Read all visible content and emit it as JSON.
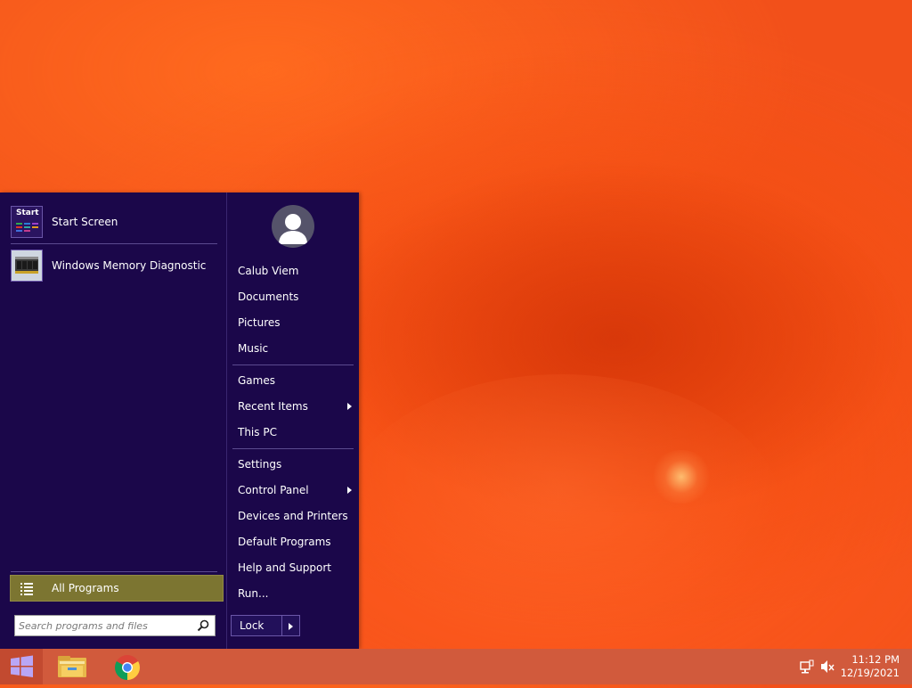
{
  "start_menu": {
    "pinned": [
      {
        "label": "Start Screen",
        "tile_text": "Start"
      },
      {
        "label": "Windows Memory Diagnostic"
      }
    ],
    "all_programs_label": "All Programs",
    "search": {
      "placeholder": "Search programs and files"
    },
    "user_name": "Calub Viem",
    "right_items": [
      {
        "label": "Documents"
      },
      {
        "label": "Pictures"
      },
      {
        "label": "Music"
      },
      {
        "label": "Games"
      },
      {
        "label": "Recent Items",
        "has_submenu": true
      },
      {
        "label": "This PC"
      },
      {
        "label": "Settings"
      },
      {
        "label": "Control Panel",
        "has_submenu": true
      },
      {
        "label": "Devices and Printers"
      },
      {
        "label": "Default Programs"
      },
      {
        "label": "Help and Support"
      },
      {
        "label": "Run..."
      }
    ],
    "lock_label": "Lock"
  },
  "taskbar": {
    "pinned_apps": [
      "file-explorer-icon",
      "chrome-icon"
    ],
    "tray_icons": [
      "network-icon",
      "volume-muted-icon"
    ],
    "clock": {
      "time": "11:12 PM",
      "date": "12/19/2021"
    }
  },
  "colors": {
    "menu_bg": "#1b074a",
    "all_programs_bg": "#7c7531",
    "taskbar_bg": "#d15a3c",
    "wallpaper": "#f2501a"
  }
}
